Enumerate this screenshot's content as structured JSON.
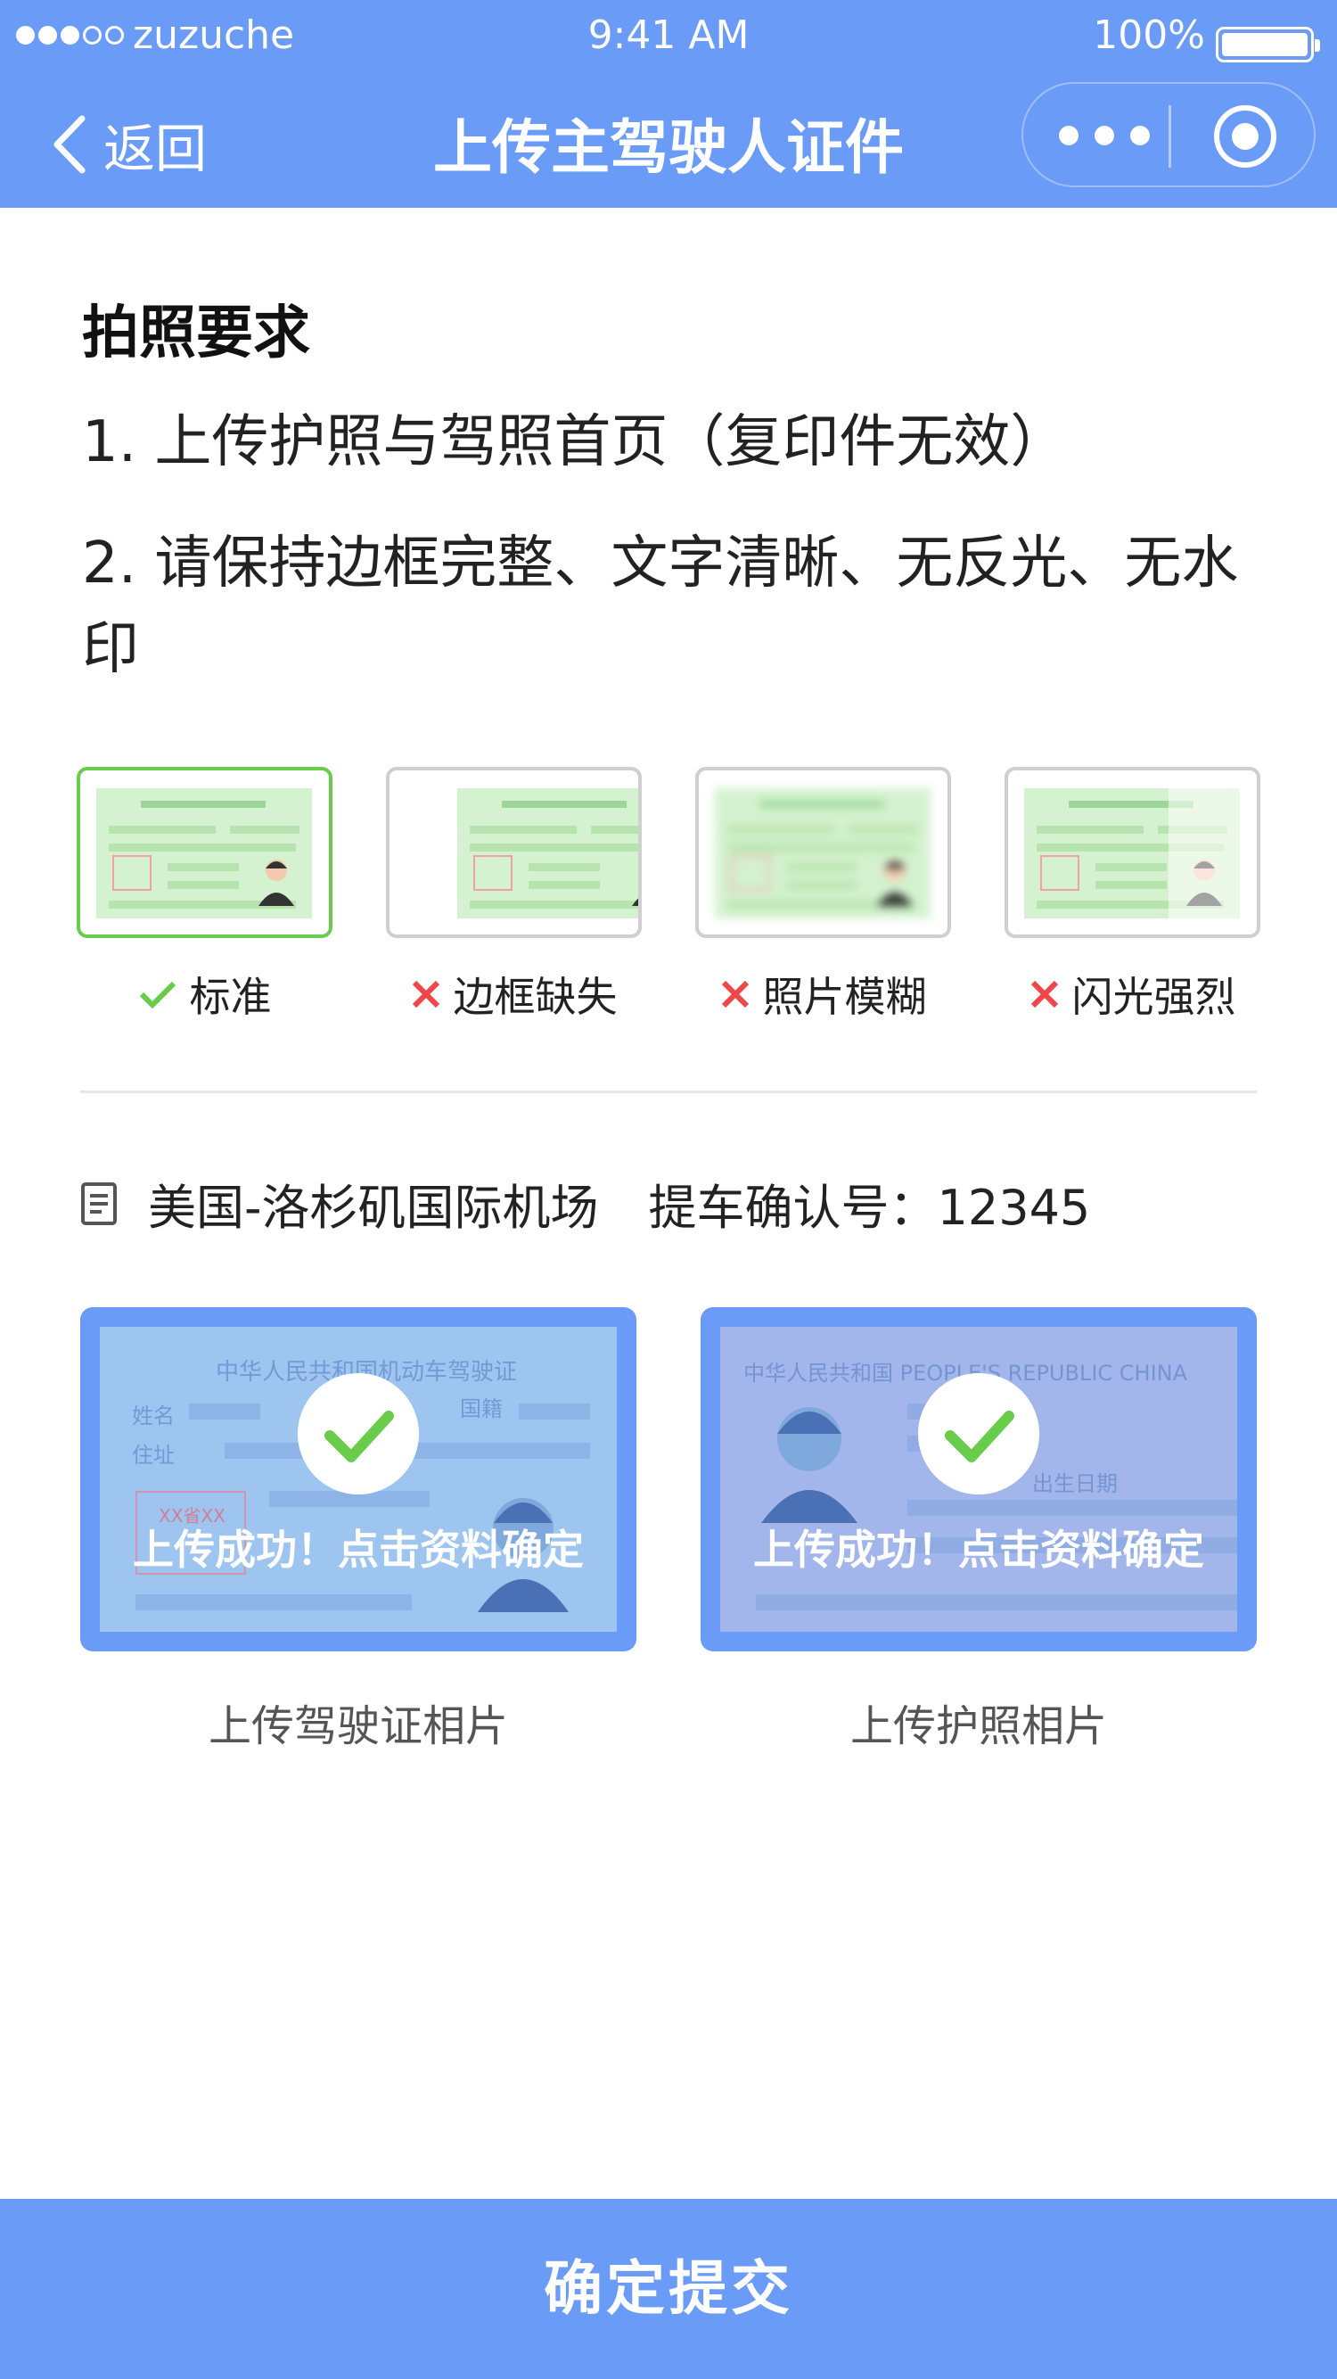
{
  "status_bar": {
    "carrier": "zuzuche",
    "time": "9:41 AM",
    "battery": "100%"
  },
  "nav": {
    "back_label": "返回",
    "title": "上传主驾驶人证件"
  },
  "requirements": {
    "title": "拍照要求",
    "items": [
      "1.  上传护照与驾照首页（复印件无效）",
      "2.  请保持边框完整、文字清晰、无反光、无水印"
    ]
  },
  "samples": [
    {
      "label": "标准",
      "status": "ok"
    },
    {
      "label": "边框缺失",
      "status": "bad"
    },
    {
      "label": "照片模糊",
      "status": "bad"
    },
    {
      "label": "闪光强烈",
      "status": "bad"
    }
  ],
  "order": {
    "location": "美国-洛杉矶国际机场",
    "confirmation": "提车确认号：12345"
  },
  "uploads": [
    {
      "status_text": "上传成功！点击资料确定",
      "label": "上传驾驶证相片",
      "ghost_title": "中华人民共和国机动车驾驶证",
      "ghost_f1": "姓名",
      "ghost_f2": "国籍",
      "ghost_f3": "住址",
      "ghost_stamp": "XX省XX"
    },
    {
      "status_text": "上传成功！点击资料确定",
      "label": "上传护照相片",
      "ghost_title": "中华人民共和国 PEOPLE'S REPUBLIC CHINA",
      "ghost_f1": "出生日期"
    }
  ],
  "submit_label": "确定提交",
  "colors": {
    "brand": "#6A9BF7",
    "ok": "#6ACC4B",
    "bad": "#F0474B"
  }
}
